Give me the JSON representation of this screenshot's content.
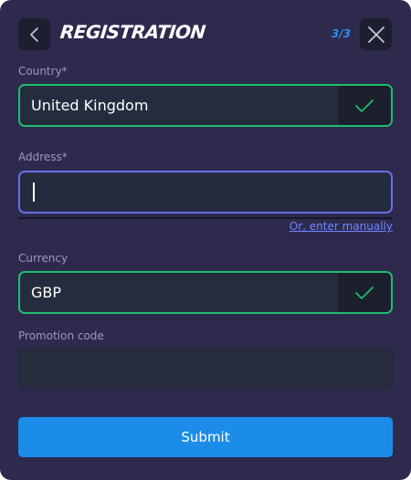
{
  "header": {
    "title": "REGISTRATION",
    "step": "3/3",
    "back_icon": "chevron-left-icon",
    "close_icon": "close-icon"
  },
  "country": {
    "label": "Country*",
    "value": "United Kingdom",
    "status_icon": "check-icon"
  },
  "address": {
    "label": "Address*",
    "value": "",
    "manual_link": "Or, enter manually"
  },
  "currency": {
    "label": "Currency",
    "value": "GBP",
    "status_icon": "check-icon"
  },
  "promotion": {
    "label": "Promotion code",
    "value": ""
  },
  "submit": {
    "label": "Submit"
  },
  "colors": {
    "background": "#2d2a4e",
    "valid_border": "#1fbd6b",
    "focus_border": "#6b6ee8",
    "accent": "#1b8de8",
    "link": "#6f86ff"
  }
}
